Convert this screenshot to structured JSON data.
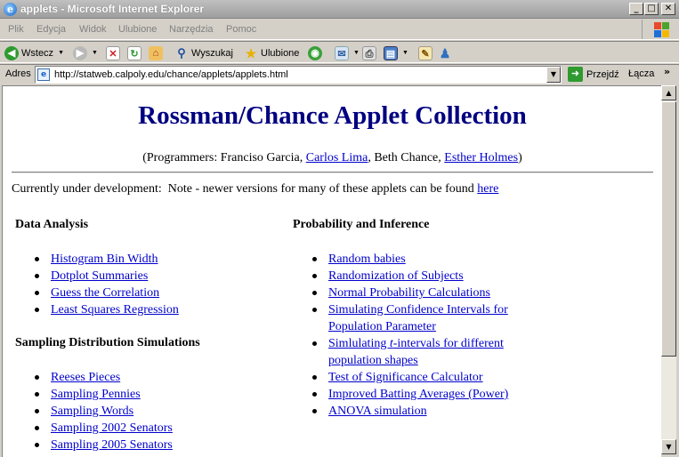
{
  "window": {
    "title": "applets - Microsoft Internet Explorer",
    "icon": "ie-icon"
  },
  "menu": [
    "Plik",
    "Edycja",
    "Widok",
    "Ulubione",
    "Narzędzia",
    "Pomoc"
  ],
  "toolbar": {
    "back_label": "Wstecz",
    "search_label": "Wyszukaj",
    "favorites_label": "Ulubione"
  },
  "address": {
    "label": "Adres",
    "url": "http://statweb.calpoly.edu/chance/applets/applets.html",
    "go_label": "Przejdź",
    "links_label": "Łącza",
    "links_chevron": "»"
  },
  "page": {
    "title": "Rossman/Chance Applet Collection",
    "credits": {
      "prefix": "(Programmers: Franciso Garcia, ",
      "link1": "Carlos Lima",
      "middle": ", Beth Chance, ",
      "link2": "Esther Holmes",
      "suffix": ")"
    },
    "note_text": "Currently under development:  Note - newer versions for many of these applets can be found ",
    "note_link": "here",
    "sections": {
      "data_analysis": {
        "title": "Data Analysis",
        "items": [
          "Histogram Bin Width",
          "Dotplot Summaries",
          "Guess the Correlation",
          "Least Squares Regression"
        ]
      },
      "sampling": {
        "title": "Sampling Distribution Simulations",
        "items": [
          "Reeses Pieces",
          "Sampling Pennies",
          "Sampling Words",
          "Sampling 2002 Senators",
          "Sampling 2005 Senators"
        ]
      },
      "probability": {
        "title": "Probability and Inference",
        "items": [
          "Random babies",
          "Randomization of Subjects",
          "Normal Probability Calculations",
          "Simulating Confidence Intervals for",
          "Population Parameter",
          "Simlulating ",
          "t",
          "-intervals for different",
          "population shapes",
          "Test of Significance Calculator",
          "Improved Batting Averages (Power)",
          "ANOVA simulation"
        ]
      }
    }
  }
}
